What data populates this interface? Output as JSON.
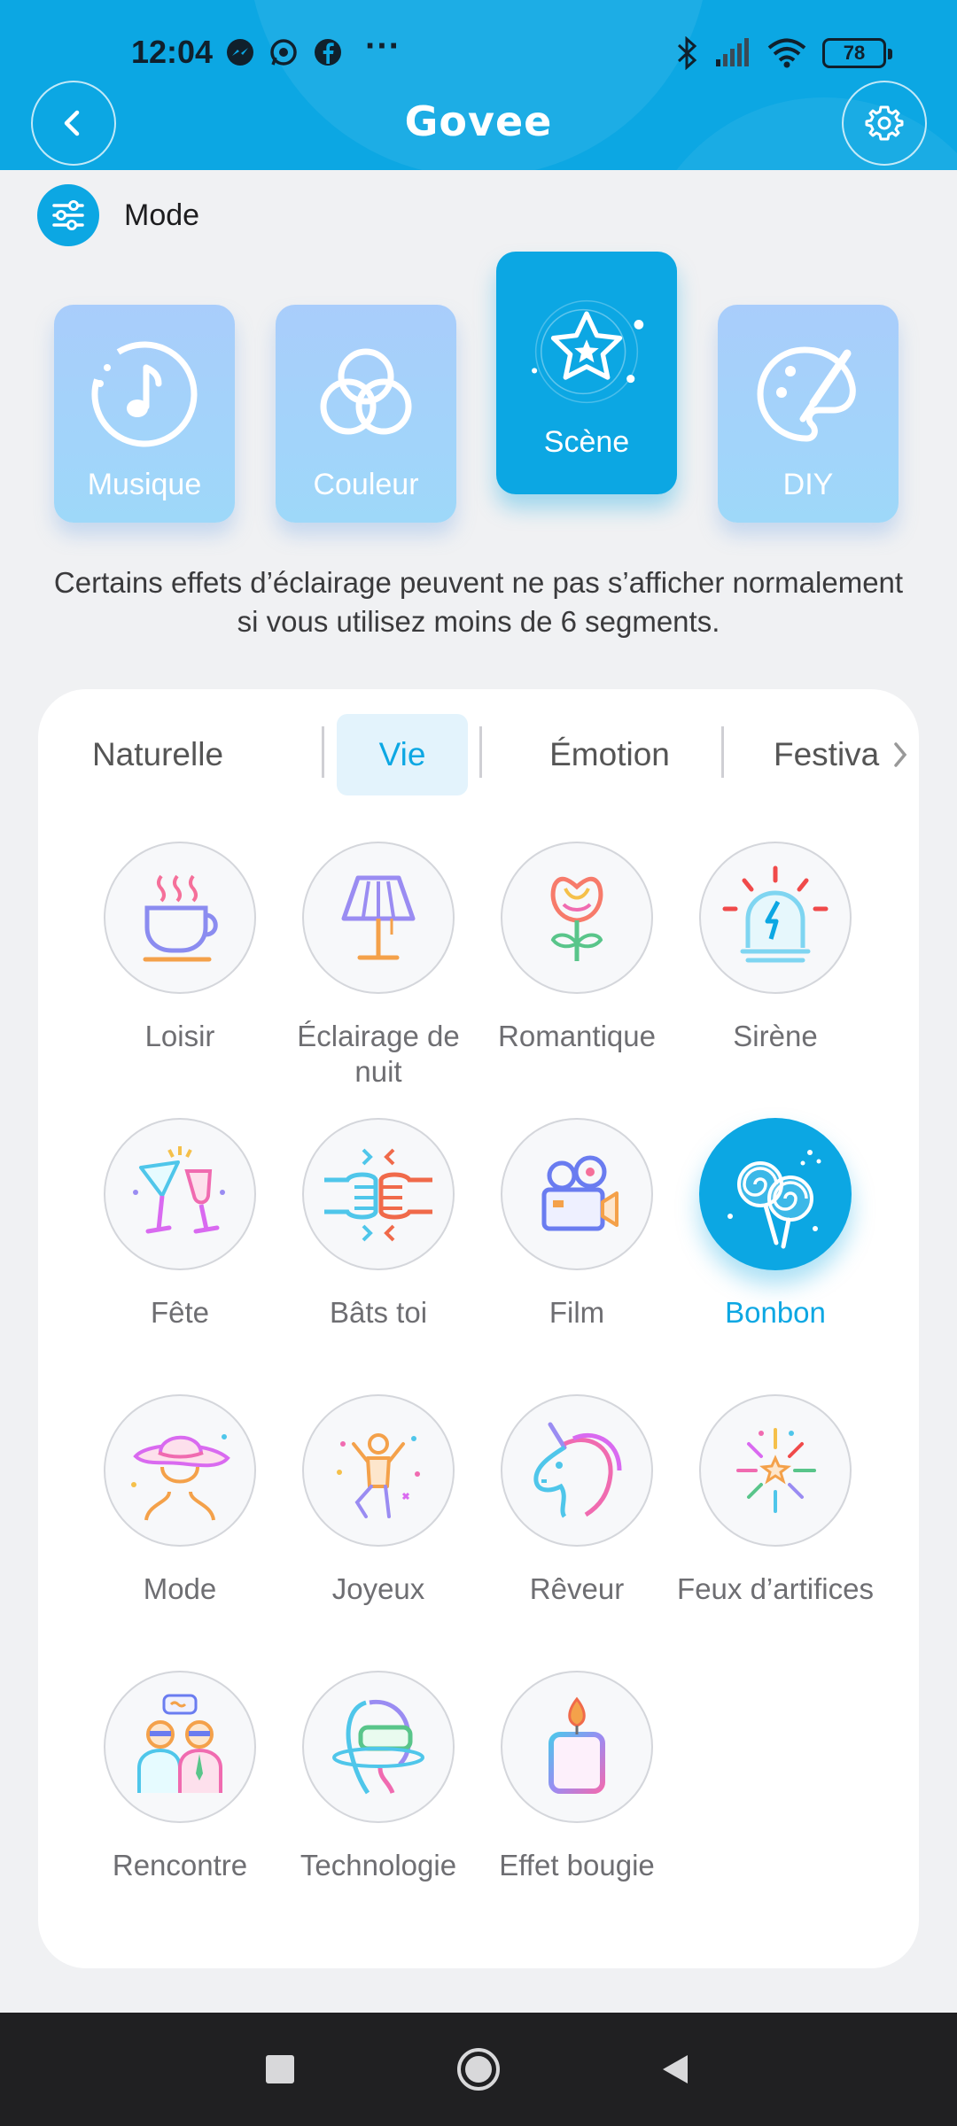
{
  "status": {
    "time": "12:04",
    "battery": "78",
    "apps": [
      "messenger-icon",
      "whatsapp-icon",
      "facebook-icon",
      "more-dots-icon"
    ],
    "icons": [
      "bluetooth-icon",
      "signal-icon",
      "wifi-icon",
      "battery-icon"
    ]
  },
  "header": {
    "logo": "Govee"
  },
  "mode": {
    "label": "Mode"
  },
  "mode_cards": [
    {
      "label": "Musique",
      "icon": "music-note-icon",
      "active": false
    },
    {
      "label": "Couleur",
      "icon": "color-circles-icon",
      "active": false
    },
    {
      "label": "Scène",
      "icon": "star-scene-icon",
      "active": true
    },
    {
      "label": "DIY",
      "icon": "palette-brush-icon",
      "active": false
    }
  ],
  "notice": "Certains effets d’éclairage peuvent ne pas s’afficher normalement si vous utilisez moins de 6 segments.",
  "tabs": [
    {
      "label": "Naturelle",
      "active": false
    },
    {
      "label": "Vie",
      "active": true
    },
    {
      "label": "Émotion",
      "active": false
    },
    {
      "label": "Festiva",
      "active": false
    }
  ],
  "scenes": [
    {
      "label": "Loisir",
      "icon": "coffee-cup-icon",
      "active": false
    },
    {
      "label": "Éclairage de nuit",
      "icon": "lamp-icon",
      "active": false
    },
    {
      "label": "Romantique",
      "icon": "rose-icon",
      "active": false
    },
    {
      "label": "Sirène",
      "icon": "siren-icon",
      "active": false
    },
    {
      "label": "Fête",
      "icon": "cocktail-glasses-icon",
      "active": false
    },
    {
      "label": "Bâts toi",
      "icon": "fist-bump-icon",
      "active": false
    },
    {
      "label": "Film",
      "icon": "movie-camera-icon",
      "active": false
    },
    {
      "label": "Bonbon",
      "icon": "lollipop-icon",
      "active": true
    },
    {
      "label": "Mode",
      "icon": "fashion-hat-icon",
      "active": false
    },
    {
      "label": "Joyeux",
      "icon": "dancing-person-icon",
      "active": false
    },
    {
      "label": "Rêveur",
      "icon": "unicorn-icon",
      "active": false
    },
    {
      "label": "Feux d’artifices",
      "icon": "fireworks-icon",
      "active": false
    },
    {
      "label": "Rencontre",
      "icon": "meeting-people-icon",
      "active": false
    },
    {
      "label": "Technologie",
      "icon": "vr-headset-icon",
      "active": false
    },
    {
      "label": "Effet bougie",
      "icon": "candle-icon",
      "active": false
    }
  ],
  "colors": {
    "accent": "#0ca7e3",
    "card_light": "#a9cdfb",
    "nav_bg": "#202022"
  }
}
